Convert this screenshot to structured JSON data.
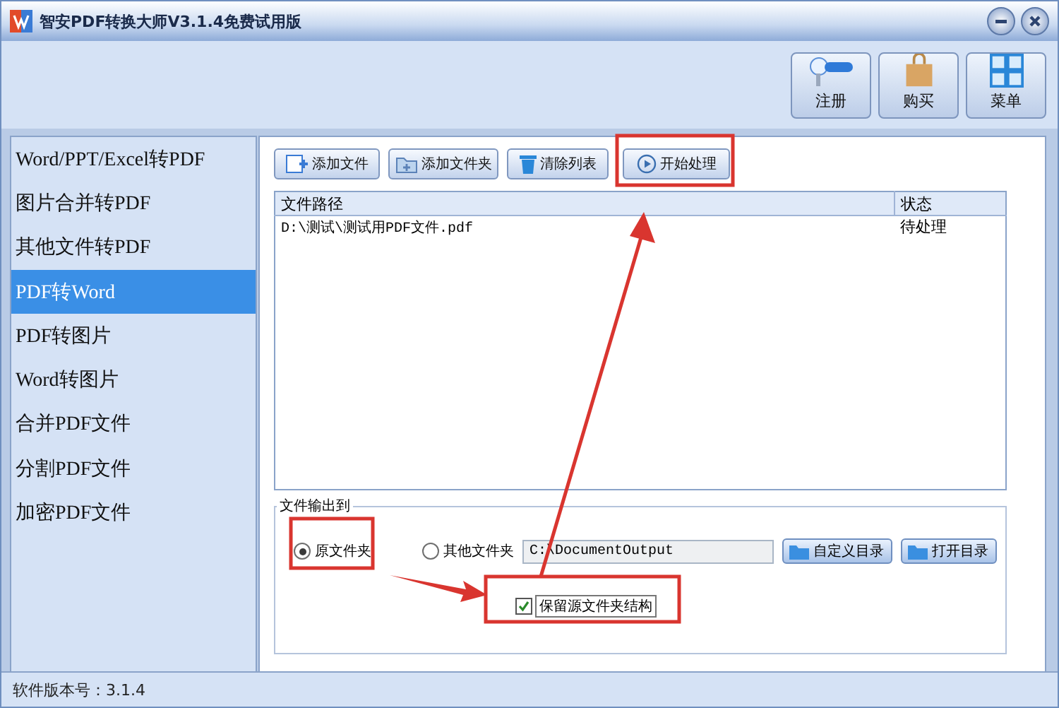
{
  "window": {
    "title": "智安PDF转换大师V3.1.4免费试用版"
  },
  "header_buttons": [
    {
      "label": "注册",
      "kind": "key"
    },
    {
      "label": "购买",
      "kind": "bag"
    },
    {
      "label": "菜单",
      "kind": "grid"
    }
  ],
  "sidebar": {
    "items": [
      {
        "label": "Word/PPT/Excel转PDF",
        "selected": false
      },
      {
        "label": "图片合并转PDF",
        "selected": false
      },
      {
        "label": "其他文件转PDF",
        "selected": false
      },
      {
        "label": "PDF转Word",
        "selected": true
      },
      {
        "label": "PDF转图片",
        "selected": false
      },
      {
        "label": "Word转图片",
        "selected": false
      },
      {
        "label": "合并PDF文件",
        "selected": false
      },
      {
        "label": "分割PDF文件",
        "selected": false
      },
      {
        "label": "加密PDF文件",
        "selected": false
      }
    ]
  },
  "toolbar": [
    {
      "label": "添加文件",
      "kind": "add-file"
    },
    {
      "label": "添加文件夹",
      "kind": "add-folder"
    },
    {
      "label": "清除列表",
      "kind": "clear"
    },
    {
      "label": "开始处理",
      "kind": "start"
    }
  ],
  "file_table": {
    "columns": [
      "文件路径",
      "状态"
    ],
    "rows": [
      [
        "D:\\测试\\测试用PDF文件.pdf",
        "待处理"
      ]
    ]
  },
  "output": {
    "legend": "文件输出到",
    "options": [
      {
        "label": "原文件夹",
        "selected": true
      },
      {
        "label": "其他文件夹",
        "selected": false
      }
    ],
    "path": "C:\\DocumentOutput",
    "buttons": [
      "自定义目录",
      "打开目录"
    ],
    "keep_structure": {
      "label": "保留源文件夹结构",
      "checked": true
    }
  },
  "status_bar": {
    "version": "软件版本号：3.1.4"
  }
}
